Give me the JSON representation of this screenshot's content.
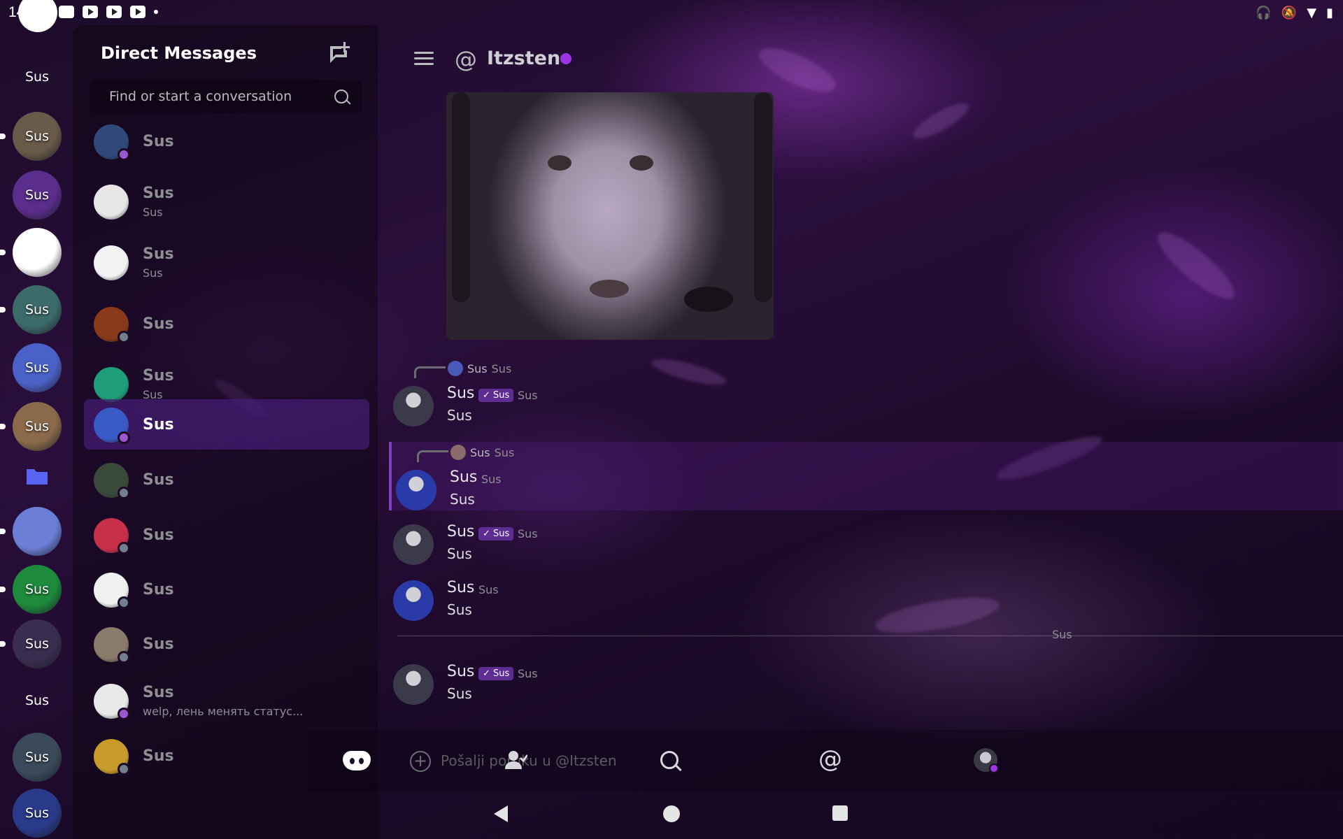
{
  "status_bar": {
    "time": "14:58"
  },
  "rail": {
    "top_label": "Sus",
    "servers": [
      {
        "label": "Sus",
        "color": "#6a5a4a",
        "pill": true
      },
      {
        "label": "Sus",
        "color": "#5b2d8c",
        "pill": false
      },
      {
        "label": "",
        "color": "#ffffff",
        "pill": true
      },
      {
        "label": "Sus",
        "color": "#3d6b6b",
        "pill": true
      },
      {
        "label": "Sus",
        "color": "#4a62c8",
        "pill": false
      },
      {
        "label": "Sus",
        "color": "#8a6a4a",
        "pill": true
      }
    ],
    "folder_icon": "folder-icon",
    "servers_2": [
      {
        "label": "",
        "color": "#6b7fd6",
        "pill": true
      },
      {
        "label": "Sus",
        "color": "#1e8a3c",
        "pill": true
      },
      {
        "label": "Sus",
        "color": "#3a2e50",
        "pill": true
      }
    ],
    "bottom_label": "Sus",
    "servers_3": [
      {
        "label": "Sus",
        "color": "#3a4a5a"
      },
      {
        "label": "Sus",
        "color": "#2a3a8a"
      }
    ]
  },
  "dm_panel": {
    "title": "Direct Messages",
    "search_placeholder": "Find or start a conversation",
    "items": [
      {
        "name": "Sus",
        "sub": "",
        "color": "#2f4a7a",
        "badge": "purple",
        "active": false
      },
      {
        "name": "Sus",
        "sub": "Sus",
        "color": "#e6e6e6",
        "badge": "",
        "active": false
      },
      {
        "name": "Sus",
        "sub": "Sus",
        "color": "#f2f2f2",
        "badge": "",
        "active": false
      },
      {
        "name": "Sus",
        "sub": "",
        "color": "#8a3a1a",
        "badge": "grey",
        "active": false
      },
      {
        "name": "Sus",
        "sub": "Sus",
        "color": "#1f9e7a",
        "badge": "",
        "active": false
      },
      {
        "name": "Sus",
        "sub": "",
        "color": "#3a5ac8",
        "badge": "purple",
        "active": true
      },
      {
        "name": "Sus",
        "sub": "",
        "color": "#3a4a3a",
        "badge": "grey",
        "active": false
      },
      {
        "name": "Sus",
        "sub": "",
        "color": "#c8304a",
        "badge": "grey",
        "active": false
      },
      {
        "name": "Sus",
        "sub": "",
        "color": "#f0f0f0",
        "badge": "grey",
        "active": false
      },
      {
        "name": "Sus",
        "sub": "",
        "color": "#8a7a6a",
        "badge": "grey",
        "active": false
      },
      {
        "name": "Sus",
        "sub": "welp, лень менять статус...",
        "color": "#e8e8e8",
        "badge": "purple",
        "active": false
      },
      {
        "name": "Sus",
        "sub": "",
        "color": "#c89a2a",
        "badge": "grey",
        "active": false
      }
    ]
  },
  "header": {
    "channel": "Itzsten"
  },
  "messages": [
    {
      "reply_to": "Sus",
      "reply_text": "Sus",
      "author": "Sus",
      "tag": "✓ Sus",
      "time": "Sus",
      "text": "Sus"
    },
    {
      "reply_to": "Sus",
      "reply_text": "Sus",
      "author": "Sus",
      "tag": "",
      "time": "Sus",
      "text": "Sus"
    },
    {
      "author": "Sus",
      "tag": "✓ Sus",
      "time": "Sus",
      "text": "Sus"
    },
    {
      "author": "Sus",
      "tag": "",
      "time": "Sus",
      "text": "Sus"
    },
    {
      "author": "Sus",
      "tag": "✓ Sus",
      "time": "Sus",
      "text": "Sus"
    }
  ],
  "divider_label": "Sus",
  "composer": {
    "placeholder": "Pošalji poruku u @Itzsten"
  }
}
